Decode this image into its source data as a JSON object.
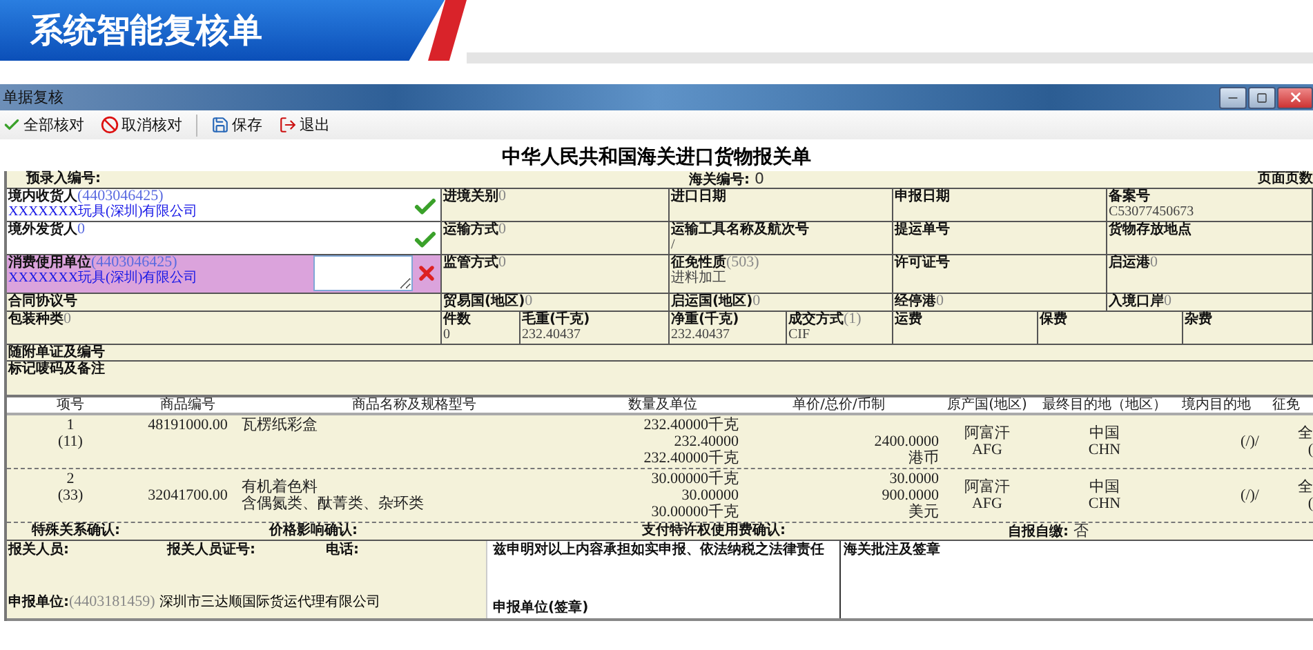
{
  "banner": {
    "title": "系统智能复核单"
  },
  "window": {
    "title": "单据复核"
  },
  "toolbar": [
    {
      "kind": "check",
      "label": "全部核对"
    },
    {
      "kind": "cancel",
      "label": "取消核对"
    },
    {
      "kind": "save",
      "label": "保存"
    },
    {
      "kind": "exit",
      "label": "退出"
    }
  ],
  "form": {
    "title": "中华人民共和国海关进口货物报关单",
    "header": [
      {
        "label": "预录入编号:"
      },
      {
        "label": "海关编号:",
        "value": "0"
      },
      {
        "label": "页面页数"
      }
    ],
    "rows": [
      [
        {
          "label": "境内收货人",
          "code": "(4403046425)",
          "value": "XXXXXXX玩具(深圳)有限公司",
          "verified": true
        },
        {
          "label": "进境关别",
          "code": "0"
        },
        {
          "label": "进口日期"
        },
        {
          "label": "申报日期"
        },
        {
          "label": "备案号",
          "value": "C53077450673"
        }
      ],
      [
        {
          "label": "境外发货人",
          "code": "0",
          "verified": true
        },
        {
          "label": "运输方式",
          "code": "0"
        },
        {
          "label": "运输工具名称及航次号",
          "value": "/"
        },
        {
          "label": "提运单号"
        },
        {
          "label": "货物存放地点"
        }
      ],
      [
        {
          "label": "消费使用单位",
          "code": "(4403046425)",
          "value": "XXXXXXX玩具(深圳)有限公司",
          "verified": false
        },
        {
          "label": "监管方式",
          "code": "0"
        },
        {
          "label": "征免性质",
          "code": "(503)",
          "value": "进料加工"
        },
        {
          "label": "许可证号"
        },
        {
          "label": "启运港",
          "code": "0"
        }
      ],
      [
        {
          "label": "合同协议号"
        },
        {
          "label": "贸易国(地区)",
          "code": "0"
        },
        {
          "label": "启运国(地区)",
          "code": "0"
        },
        {
          "label": "经停港",
          "code": "0"
        },
        {
          "label": "入境口岸",
          "code": "0"
        }
      ]
    ],
    "measures": [
      {
        "label": "包装种类",
        "code": "0"
      },
      {
        "label": "件数",
        "value": "0"
      },
      {
        "label": "毛重(千克)",
        "value": "232.40437"
      },
      {
        "label": "净重(千克)",
        "value": "232.40437"
      },
      {
        "label": "成交方式",
        "code": "(1)",
        "value": "CIF"
      },
      {
        "label": "运费"
      },
      {
        "label": "保费"
      },
      {
        "label": "杂费"
      }
    ],
    "attachments": {
      "label": "随附单证及编号"
    },
    "remarks": {
      "label": "标记唛码及备注"
    },
    "goods": {
      "columns": [
        "项号",
        "商品编号",
        "商品名称及规格型号",
        "数量及单位",
        "单价/总价/币制",
        "原产国(地区)",
        "最终目的地（地区）",
        "境内目的地",
        "征免"
      ],
      "rows": [
        {
          "item": [
            "1",
            "(11)"
          ],
          "code": "48191000.00",
          "name": [
            "瓦楞纸彩盒"
          ],
          "quantity": [
            "232.40000千克",
            "232.40000",
            "232.40000千克"
          ],
          "price": [
            "2400.0000",
            "港币"
          ],
          "origin": [
            "阿富汗",
            "AFG"
          ],
          "destination": [
            "中国",
            "CHN"
          ],
          "domestic": "(/)/",
          "exemption": [
            "全",
            "("
          ]
        },
        {
          "item": [
            "2",
            "(33)"
          ],
          "code": "32041700.00",
          "name": [
            "有机着色料",
            "含偶氮类、酞菁类、杂环类"
          ],
          "quantity": [
            "30.00000千克",
            "30.00000",
            "30.00000千克"
          ],
          "price": [
            "30.0000",
            "900.0000",
            "美元"
          ],
          "origin": [
            "阿富汗",
            "AFG"
          ],
          "destination": [
            "中国",
            "CHN"
          ],
          "domestic": "(/)/",
          "exemption": [
            "全",
            "("
          ]
        }
      ]
    },
    "confirmations": [
      {
        "label": "特殊关系确认:"
      },
      {
        "label": "价格影响确认:"
      },
      {
        "label": "支付特许权使用费确认:"
      },
      {
        "label": "自报自缴:",
        "value": "否"
      }
    ],
    "declarant": {
      "fields": [
        {
          "label": "报关人员:"
        },
        {
          "label": "报关人员证号:"
        },
        {
          "label": "电话:"
        }
      ],
      "unit": {
        "label": "申报单位:",
        "code": "(4403181459)",
        "value": "深圳市三达顺国际货运代理有限公司"
      }
    },
    "statement": {
      "text": "兹申明对以上内容承担如实申报、依法纳税之法律责任",
      "signature": "申报单位(签章)"
    },
    "customs": {
      "label": "海关批注及签章"
    }
  }
}
